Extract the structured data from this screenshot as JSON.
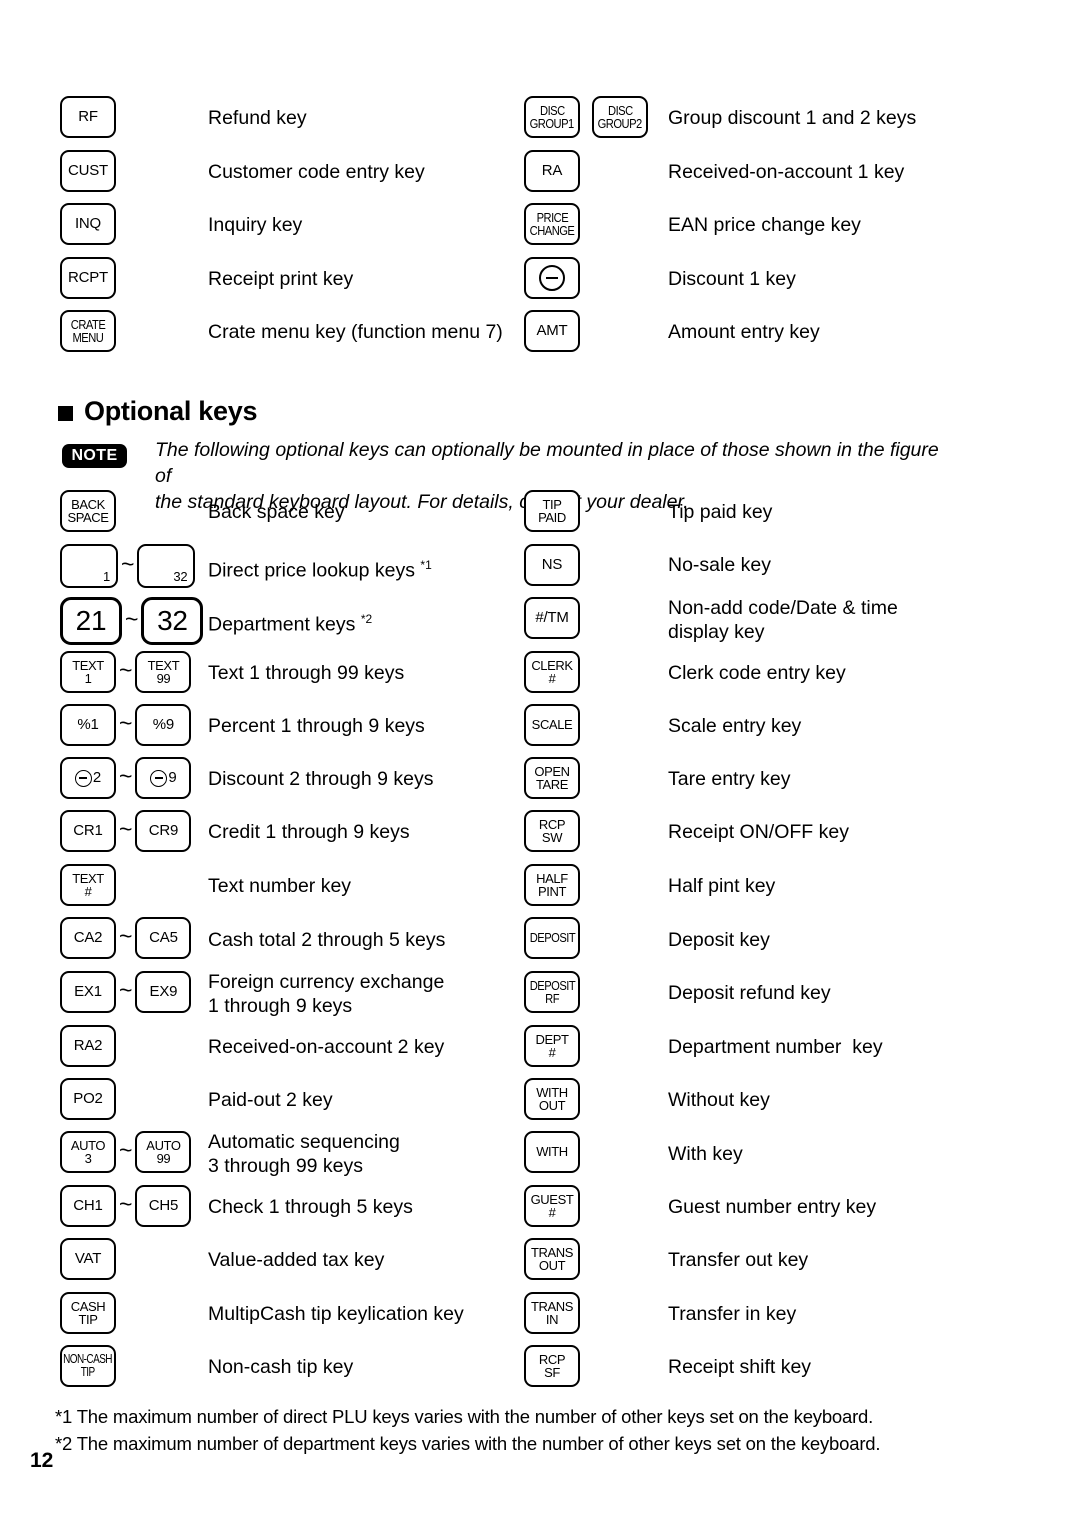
{
  "standard_keys": [
    {
      "keys": [
        {
          "lines": [
            "RF"
          ],
          "style": "std"
        }
      ],
      "description": "Refund key"
    },
    {
      "keys": [
        {
          "lines": [
            "CUST"
          ],
          "style": "std"
        }
      ],
      "description": "Customer code entry key"
    },
    {
      "keys": [
        {
          "lines": [
            "INQ"
          ],
          "style": "std"
        }
      ],
      "description": "Inquiry key"
    },
    {
      "keys": [
        {
          "lines": [
            "RCPT"
          ],
          "style": "std"
        }
      ],
      "description": "Receipt print key"
    },
    {
      "keys": [
        {
          "lines": [
            "CRATE",
            "MENU"
          ],
          "style": "std-cond"
        }
      ],
      "description": "Crate menu key (function menu 7)"
    }
  ],
  "standard_keys_right": [
    {
      "keys": [
        {
          "lines": [
            "DISC",
            "GROUP1"
          ],
          "style": "std-cond"
        },
        {
          "lines": [
            "DISC",
            "GROUP2"
          ],
          "style": "std-cond"
        }
      ],
      "description": "Group discount 1 and 2 keys"
    },
    {
      "keys": [
        {
          "lines": [
            "RA"
          ],
          "style": "std"
        }
      ],
      "description": "Received-on-account 1 key"
    },
    {
      "keys": [
        {
          "lines": [
            "PRICE",
            "CHANGE"
          ],
          "style": "std-cond"
        }
      ],
      "description": "EAN price change key"
    },
    {
      "keys": [
        {
          "lines": [
            "⊖"
          ],
          "style": "std-ominus"
        }
      ],
      "description": "Discount 1 key"
    },
    {
      "keys": [
        {
          "lines": [
            "AMT"
          ],
          "style": "std"
        }
      ],
      "description": "Amount entry key"
    }
  ],
  "section": {
    "heading": "Optional keys",
    "bullet_icon": "filled-square"
  },
  "note": {
    "badge": "NOTE",
    "text": "The following optional keys can optionally be mounted in place of those shown in the figure of\nthe standard keyboard layout. For details, consult your dealer."
  },
  "optional_keys_left": [
    {
      "keys": [
        {
          "lines": [
            "BACK",
            "SPACE"
          ],
          "style": "std-sm"
        }
      ],
      "description": "Back space key"
    },
    {
      "keys": [
        {
          "lines": [],
          "corner": "1",
          "style": "plu"
        },
        {
          "lines": [],
          "corner": "32",
          "style": "plu"
        }
      ],
      "range": true,
      "description": "Direct price lookup keys ",
      "footnote_ref": "*1"
    },
    {
      "keys": [
        {
          "lines": [
            "21"
          ],
          "style": "dept"
        },
        {
          "lines": [
            "32"
          ],
          "style": "dept"
        }
      ],
      "range": true,
      "description": "Department keys ",
      "footnote_ref": "*2"
    },
    {
      "keys": [
        {
          "lines": [
            "TEXT",
            "1"
          ],
          "style": "std-sm"
        },
        {
          "lines": [
            "TEXT",
            "99"
          ],
          "style": "std-sm"
        }
      ],
      "range": true,
      "description": "Text 1 through 99 keys"
    },
    {
      "keys": [
        {
          "lines": [
            "%1"
          ],
          "style": "std"
        },
        {
          "lines": [
            "%9"
          ],
          "style": "std"
        }
      ],
      "range": true,
      "description": "Percent 1 through 9 keys"
    },
    {
      "keys": [
        {
          "lines": [
            "⊖2"
          ],
          "style": "std-discnum"
        },
        {
          "lines": [
            "⊖9"
          ],
          "style": "std-discnum"
        }
      ],
      "range": true,
      "description": "Discount 2 through 9 keys"
    },
    {
      "keys": [
        {
          "lines": [
            "CR1"
          ],
          "style": "std"
        },
        {
          "lines": [
            "CR9"
          ],
          "style": "std"
        }
      ],
      "range": true,
      "description": "Credit 1 through 9 keys"
    },
    {
      "keys": [
        {
          "lines": [
            "TEXT",
            "#"
          ],
          "style": "std-sm"
        }
      ],
      "description": "Text number key"
    },
    {
      "keys": [
        {
          "lines": [
            "CA2"
          ],
          "style": "std"
        },
        {
          "lines": [
            "CA5"
          ],
          "style": "std"
        }
      ],
      "range": true,
      "description": "Cash total 2 through 5 keys"
    },
    {
      "keys": [
        {
          "lines": [
            "EX1"
          ],
          "style": "std"
        },
        {
          "lines": [
            "EX9"
          ],
          "style": "std"
        }
      ],
      "range": true,
      "description": "Foreign currency exchange\n1 through 9 keys"
    },
    {
      "keys": [
        {
          "lines": [
            "RA2"
          ],
          "style": "std"
        }
      ],
      "description": "Received-on-account 2 key"
    },
    {
      "keys": [
        {
          "lines": [
            "PO2"
          ],
          "style": "std"
        }
      ],
      "description": "Paid-out 2 key"
    },
    {
      "keys": [
        {
          "lines": [
            "AUTO",
            "3"
          ],
          "style": "std-sm"
        },
        {
          "lines": [
            "AUTO",
            "99"
          ],
          "style": "std-sm"
        }
      ],
      "range": true,
      "description": "Automatic sequencing\n3 through 99 keys"
    },
    {
      "keys": [
        {
          "lines": [
            "CH1"
          ],
          "style": "std"
        },
        {
          "lines": [
            "CH5"
          ],
          "style": "std"
        }
      ],
      "range": true,
      "description": "Check 1 through 5 keys"
    },
    {
      "keys": [
        {
          "lines": [
            "VAT"
          ],
          "style": "std"
        }
      ],
      "description": "Value-added tax key"
    },
    {
      "keys": [
        {
          "lines": [
            "CASH",
            "TIP"
          ],
          "style": "std-sm"
        }
      ],
      "description": "MultipCash tip keylication key"
    },
    {
      "keys": [
        {
          "lines": [
            "NON-CASH",
            "TIP"
          ],
          "style": "std-cond2"
        }
      ],
      "description": "Non-cash tip key"
    }
  ],
  "optional_keys_right": [
    {
      "keys": [
        {
          "lines": [
            "TIP",
            "PAID"
          ],
          "style": "std-sm"
        }
      ],
      "description": "Tip paid key"
    },
    {
      "keys": [
        {
          "lines": [
            "NS"
          ],
          "style": "std"
        }
      ],
      "description": "No-sale key"
    },
    {
      "keys": [
        {
          "lines": [
            "#/TM"
          ],
          "style": "std"
        }
      ],
      "description": "Non-add code/Date & time\ndisplay key"
    },
    {
      "keys": [
        {
          "lines": [
            "CLERK",
            "#"
          ],
          "style": "std-sm"
        }
      ],
      "description": "Clerk code entry key"
    },
    {
      "keys": [
        {
          "lines": [
            "SCALE"
          ],
          "style": "std-sm"
        }
      ],
      "description": "Scale entry key"
    },
    {
      "keys": [
        {
          "lines": [
            "OPEN",
            "TARE"
          ],
          "style": "std-sm"
        }
      ],
      "description": "Tare entry key"
    },
    {
      "keys": [
        {
          "lines": [
            "RCP",
            "SW"
          ],
          "style": "std-sm"
        }
      ],
      "description": "Receipt ON/OFF key"
    },
    {
      "keys": [
        {
          "lines": [
            "HALF",
            "PINT"
          ],
          "style": "std-sm"
        }
      ],
      "description": "Half pint key"
    },
    {
      "keys": [
        {
          "lines": [
            "DEPOSIT"
          ],
          "style": "std-cond"
        }
      ],
      "description": "Deposit key"
    },
    {
      "keys": [
        {
          "lines": [
            "DEPOSIT",
            "RF"
          ],
          "style": "std-cond"
        }
      ],
      "description": "Deposit refund key"
    },
    {
      "keys": [
        {
          "lines": [
            "DEPT",
            "#"
          ],
          "style": "std-sm"
        }
      ],
      "description": "Department number  key"
    },
    {
      "keys": [
        {
          "lines": [
            "WITH",
            "OUT"
          ],
          "style": "std-sm"
        }
      ],
      "description": "Without key"
    },
    {
      "keys": [
        {
          "lines": [
            "WITH"
          ],
          "style": "std-sm"
        }
      ],
      "description": "With key"
    },
    {
      "keys": [
        {
          "lines": [
            "GUEST",
            "#"
          ],
          "style": "std-sm"
        }
      ],
      "description": "Guest number entry key"
    },
    {
      "keys": [
        {
          "lines": [
            "TRANS",
            "OUT"
          ],
          "style": "std-sm"
        }
      ],
      "description": "Transfer out key"
    },
    {
      "keys": [
        {
          "lines": [
            "TRANS",
            "IN"
          ],
          "style": "std-sm"
        }
      ],
      "description": "Transfer in key"
    },
    {
      "keys": [
        {
          "lines": [
            "RCP",
            "SF"
          ],
          "style": "std-sm"
        }
      ],
      "description": "Receipt shift key"
    }
  ],
  "footnotes": [
    "*1 The maximum number of direct PLU keys varies with the number of other keys set on the keyboard.",
    "*2 The maximum number of department keys varies with the number of other keys set on the keyboard."
  ],
  "page_number": "12",
  "tilde_glyph": "~"
}
